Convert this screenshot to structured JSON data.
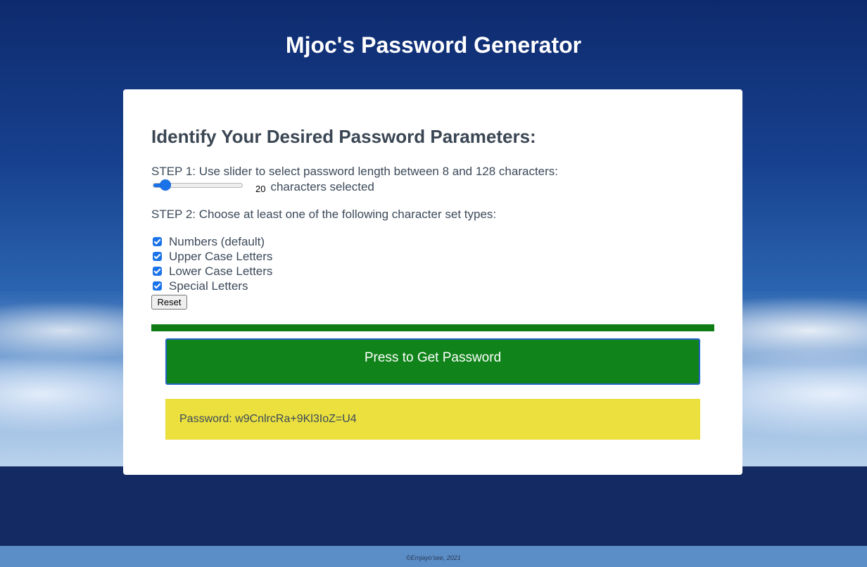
{
  "header": {
    "title": "Mjoc's Password Generator"
  },
  "card": {
    "heading": "Identify Your Desired Password Parameters:",
    "step1_text": "STEP 1: Use slider to select password length between 8 and 128 characters:",
    "slider": {
      "min": 8,
      "max": 128,
      "value": 20,
      "value_label": "20",
      "suffix": "characters selected"
    },
    "step2_text": "STEP 2: Choose at least one of the following character set types:",
    "options": [
      {
        "label": "Numbers (default)",
        "checked": true
      },
      {
        "label": "Upper Case Letters",
        "checked": true
      },
      {
        "label": "Lower Case Letters",
        "checked": true
      },
      {
        "label": "Special Letters",
        "checked": true
      }
    ],
    "reset_label": "Reset",
    "generate_label": "Press to Get Password",
    "password_text": "Password: w9CnlrcRa+9Kl3IoZ=U4"
  },
  "footer": {
    "text": "©Emjayo'see, 2021"
  },
  "colors": {
    "accent_green": "#10841a",
    "password_bg": "#ebe03e",
    "control_blue": "#1a73e8"
  }
}
